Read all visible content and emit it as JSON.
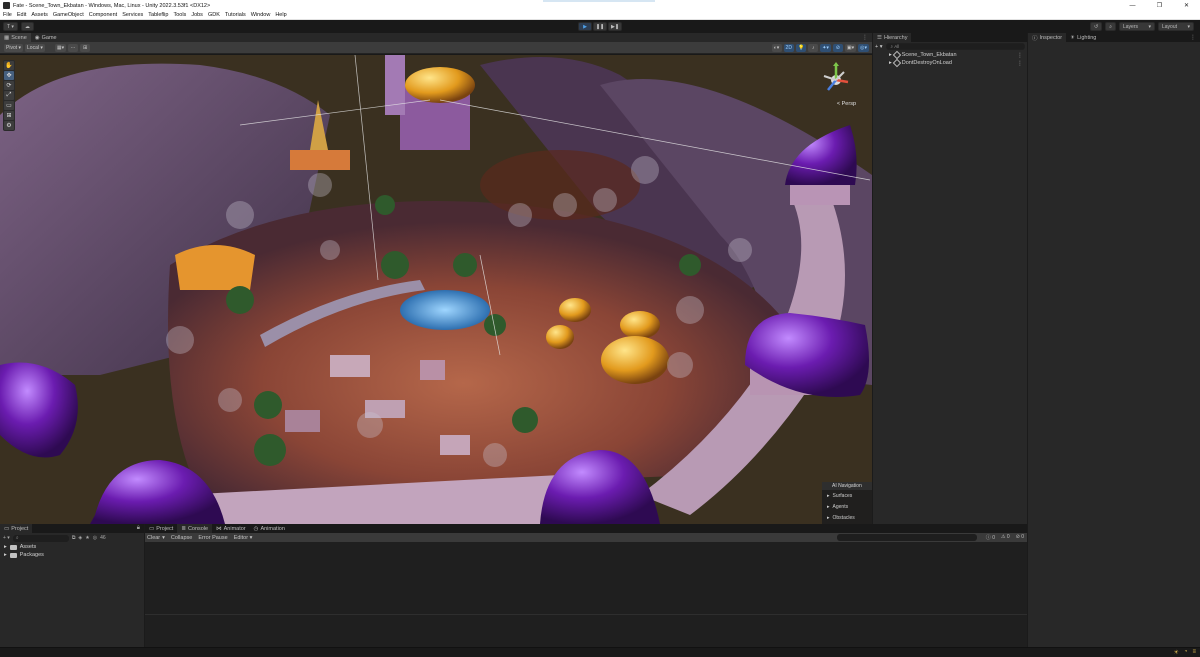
{
  "window": {
    "title": "Fate - Scene_Town_Ekbatan - Windows, Mac, Linux - Unity 2022.3.53f1 <DX12>",
    "controls": [
      "—",
      "❐",
      "✕"
    ]
  },
  "menu": [
    "File",
    "Edit",
    "Assets",
    "GameObject",
    "Component",
    "Services",
    "Tableflip",
    "Tools",
    "Jobs",
    "GDK",
    "Tutorials",
    "Window",
    "Help"
  ],
  "toolbar": {
    "account": "T ▾",
    "cloud": "☁",
    "play": "▶",
    "pause": "❚❚",
    "step": "▶❚",
    "layers": "Layers",
    "layout": "Layout",
    "history": "↺",
    "search": "⌕"
  },
  "scene": {
    "tabs": [
      "Scene",
      "Game"
    ],
    "pivot": "Pivot ▾",
    "local": "Local ▾",
    "mode_2d": "2D",
    "persp": "< Persp",
    "tools": [
      "✋",
      "✥",
      "⟳",
      "⤢",
      "▭",
      "⊞",
      "⚙"
    ]
  },
  "ai_navigation": {
    "title": "AI Navigation",
    "items": [
      "Surfaces",
      "Agents",
      "Obstacles"
    ]
  },
  "hierarchy": {
    "tab": "Hierarchy",
    "add": "+ ▾",
    "search_placeholder": "All",
    "items": [
      "Scene_Town_Ekbatan",
      "DontDestroyOnLoad"
    ]
  },
  "inspector": {
    "tabs": [
      "Inspector",
      "Lighting"
    ]
  },
  "project": {
    "tab": "Project",
    "add": "+ ▾",
    "count": "46",
    "items": [
      "Assets",
      "Packages"
    ]
  },
  "console": {
    "tabs": [
      "Project",
      "Console",
      "Animator",
      "Animation"
    ],
    "actions": [
      "Clear",
      "Collapse",
      "Error Pause",
      "Editor ▾"
    ],
    "counts": [
      "0",
      "0",
      "0"
    ]
  },
  "colors": {
    "panel": "#282828",
    "accent": "#4ea0e8",
    "warning": "#d9b650"
  }
}
